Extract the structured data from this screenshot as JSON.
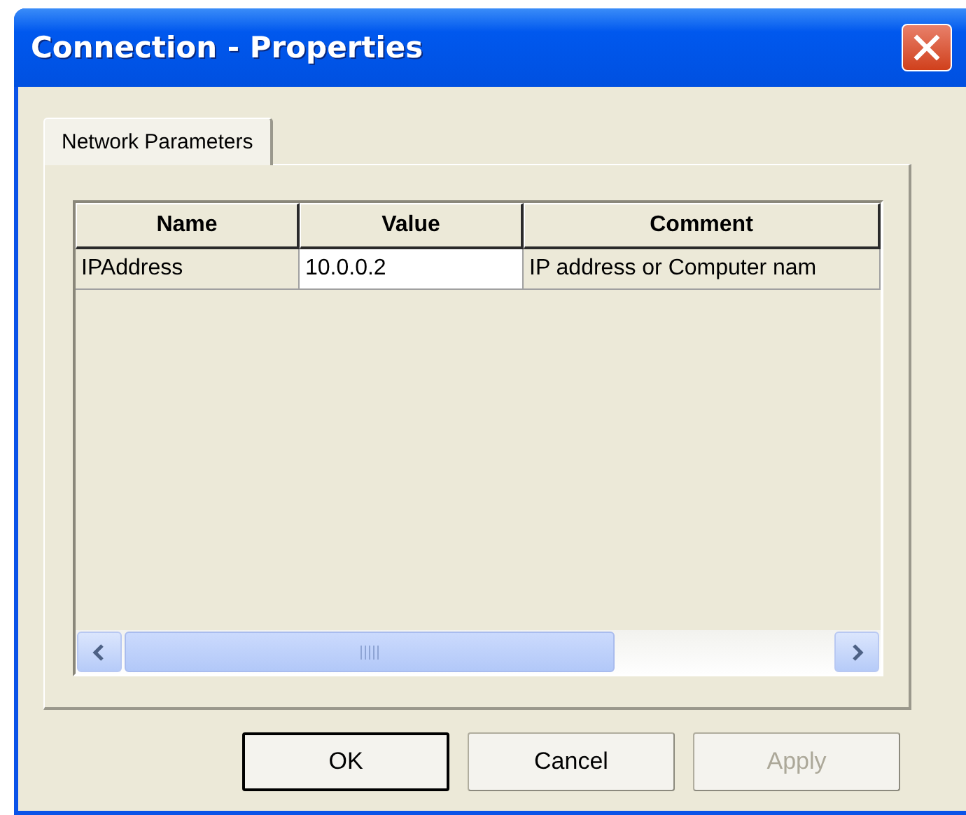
{
  "window": {
    "title": "Connection - Properties"
  },
  "tabs": [
    {
      "label": "Network Parameters",
      "selected": true
    }
  ],
  "table": {
    "columns": [
      "Name",
      "Value",
      "Comment"
    ],
    "rows": [
      {
        "cells": [
          "IPAddress",
          "10.0.0.2",
          "IP address or Computer nam"
        ]
      }
    ]
  },
  "buttons": [
    {
      "label": "OK",
      "default": true,
      "disabled": false
    },
    {
      "label": "Cancel",
      "default": false,
      "disabled": false
    },
    {
      "label": "Apply",
      "default": false,
      "disabled": true
    }
  ]
}
